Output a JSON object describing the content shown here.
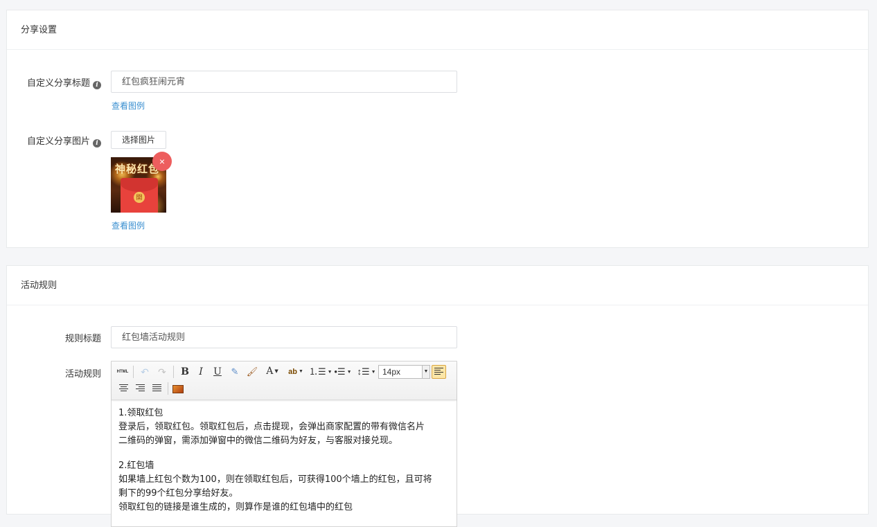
{
  "share_section": {
    "title": "分享设置",
    "share_title_label": "自定义分享标题",
    "share_title_value": "红包疯狂闹元宵",
    "example_link_1": "查看图例",
    "share_image_label": "自定义分享图片",
    "select_image_button": "选择图片",
    "thumbnail_text": "神秘红包",
    "thumbnail_seal": "開",
    "remove_symbol": "×",
    "example_link_2": "查看图例"
  },
  "rules_section": {
    "title": "活动规则",
    "rule_title_label": "规则标题",
    "rule_title_value": "红包墙活动规则",
    "rule_content_label": "活动规则",
    "toolbar": {
      "html": "HTML",
      "bold": "B",
      "italic": "I",
      "underline": "U",
      "font_color": "A",
      "highlight": "ab",
      "font_size": "14px"
    },
    "content": {
      "p1_title": "1.领取红包",
      "p1_line1": "登录后，领取红包。领取红包后，点击提现，会弹出商家配置的带有微信名片",
      "p1_line2": "二维码的弹窗，需添加弹窗中的微信二维码为好友，与客服对接兑现。",
      "p2_title": "2.红包墙",
      "p2_line1": "如果墙上红包个数为100，则在领取红包后，可获得100个墙上的红包，且可将",
      "p2_line2": "剩下的99个红包分享给好友。",
      "p2_line3": "领取红包的链接是谁生成的，则算作是谁的红包墙中的红包"
    }
  },
  "colors": {
    "link": "#3a8fd0",
    "remove": "#ed5e5e",
    "border": "#dcdee2"
  }
}
